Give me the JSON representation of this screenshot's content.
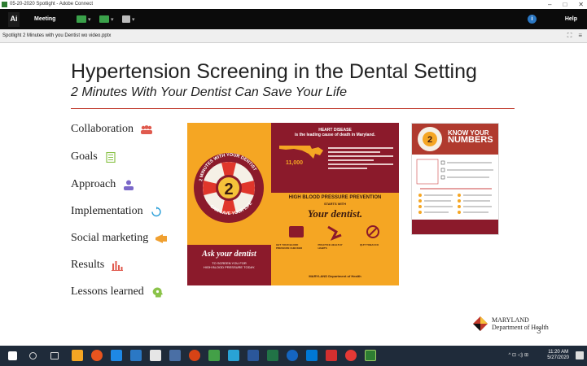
{
  "window": {
    "title": "05-20-2020 Spotlight - Adobe Connect",
    "minimize": "–",
    "maximize": "□",
    "close": "✕"
  },
  "menubar": {
    "logo": "Ai",
    "meeting": "Meeting",
    "help": "Help",
    "info": "i"
  },
  "pod": {
    "title": "Spotlight 2 Minutes with you Dentist wo video.pptx",
    "fullscreen": "⛶",
    "menu": "≡"
  },
  "slide": {
    "title": "Hypertension Screening in the Dental Setting",
    "subtitle": "2 Minutes With Your Dentist Can Save Your Life",
    "bullets": [
      {
        "label": "Collaboration",
        "icon": "people-icon",
        "color": "#e05a4e"
      },
      {
        "label": "Goals",
        "icon": "checklist-icon",
        "color": "#8bc34a"
      },
      {
        "label": "Approach",
        "icon": "person-icon",
        "color": "#7b68c9"
      },
      {
        "label": "Implementation",
        "icon": "refresh-icon",
        "color": "#2b9fd8"
      },
      {
        "label": "Social marketing",
        "icon": "megaphone-icon",
        "color": "#f0a030"
      },
      {
        "label": "Results",
        "icon": "barchart-icon",
        "color": "#e05a4e"
      },
      {
        "label": "Lessons learned",
        "icon": "head-gear-icon",
        "color": "#8bc34a"
      }
    ],
    "poster1": {
      "number": "2",
      "arc_top": "2 MINUTES WITH YOUR DENTIST",
      "arc_bottom": "CAN SAVE YOUR LIFE",
      "ask": "Ask your dentist",
      "small1": "TO SCREEN YOU FOR",
      "small2": "HIGH BLOOD PRESSURE TODAY."
    },
    "poster2": {
      "header1": "HEART DISEASE",
      "header2": "is the leading cause of death in Maryland.",
      "stat": "11,000",
      "middle1": "HIGH BLOOD PRESSURE PREVENTION",
      "middle2": "STARTS WITH",
      "your_dentist": "Your dentist.",
      "col1": "GET YOUR BLOOD PRESSURE CHECKED",
      "col2": "PRACTICE HEALTHY HABITS",
      "col3": "QUIT TOBACCO",
      "footer": "MARYLAND Department of Health"
    },
    "poster3": {
      "know": "KNOW YOUR",
      "numbers": "NUMBERS"
    },
    "logo_line1": "MARYLAND",
    "logo_line2": "Department of Health",
    "page_number": "3"
  },
  "taskbar": {
    "time": "11:20 AM",
    "date": "5/27/2020",
    "tray": "^ ⊡ ◁) ⊞"
  },
  "colors": {
    "menubar": "#0b0b0b",
    "accent_red": "#c0392b",
    "poster_orange": "#f5a623",
    "poster_maroon": "#8b1a2b",
    "taskbar": "#1f2b3a"
  }
}
